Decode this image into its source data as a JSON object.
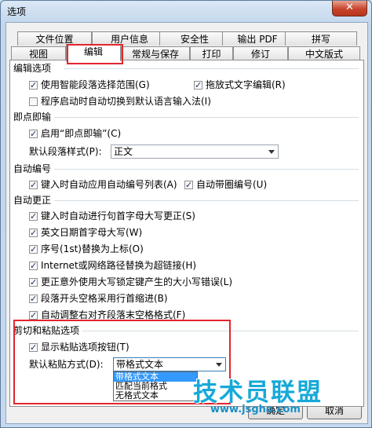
{
  "window": {
    "title": "选项",
    "close_glyph": "✕"
  },
  "tabs_row1": [
    {
      "label": "文件位置"
    },
    {
      "label": "用户信息"
    },
    {
      "label": "安全性"
    },
    {
      "label": "输出 PDF"
    },
    {
      "label": "拼写"
    }
  ],
  "tabs_row2": [
    {
      "label": "视图"
    },
    {
      "label": "编辑",
      "active": true
    },
    {
      "label": "常规与保存"
    },
    {
      "label": "打印"
    },
    {
      "label": "修订"
    },
    {
      "label": "中文版式"
    }
  ],
  "edit_options": {
    "header": "编辑选项",
    "smart_select": "使用智能段落选择范围(G)",
    "drag_drop": "拖放式文字编辑(R)",
    "auto_switch_ime": "程序启动时自动切换到默认语言输入法(I)"
  },
  "click_and_type": {
    "header": "即点即输",
    "enable": "启用“即点即输”(C)",
    "default_style_label": "默认段落样式(P):",
    "default_style_value": "正文"
  },
  "auto_numbering": {
    "header": "自动编号",
    "auto_list": "键入时自动应用自动编号列表(A)",
    "auto_circle": "自动带圈编号(U)"
  },
  "auto_correct": {
    "header": "自动更正",
    "items": [
      "键入时自动进行句首字母大写更正(S)",
      "英文日期首字母大写(W)",
      "序号(1st)替换为上标(O)",
      "Internet或网络路径替换为超链接(H)",
      "更正意外使用大写锁定键产生的大小写错误(L)",
      "段落开头空格采用行首缩进(B)",
      "自动调整右对齐段落末空格格式(F)"
    ]
  },
  "cut_paste": {
    "header": "剪切和粘贴选项",
    "show_paste_button": "显示粘贴选项按钮(T)",
    "default_paste_label": "默认粘贴方式(D):",
    "default_paste_value": "带格式文本",
    "options": [
      "带格式文本",
      "匹配当前格式",
      "无格式文本"
    ]
  },
  "buttons": {
    "ok": "确定",
    "cancel": "取消"
  },
  "watermark": {
    "main": "技术员联盟",
    "url": "www.jsgho.com"
  }
}
